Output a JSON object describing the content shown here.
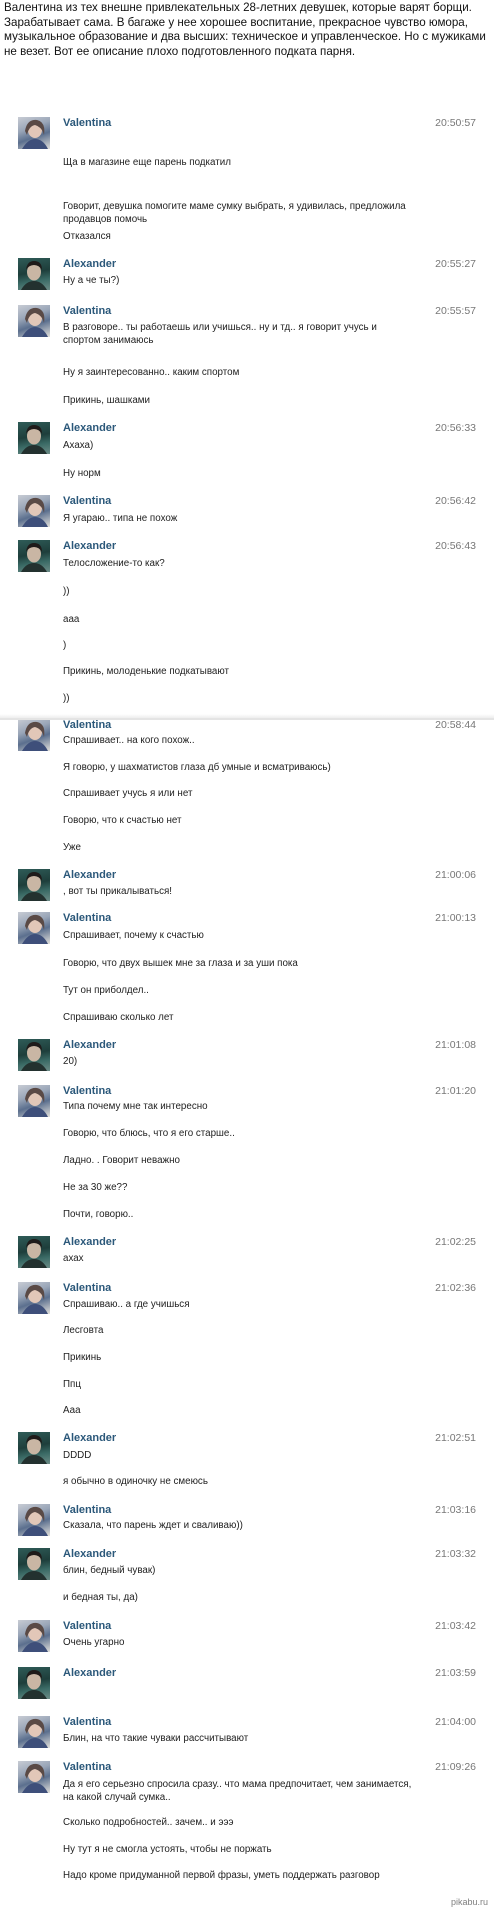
{
  "intro": "Валентина из тех внешне привлекательных 28-летних девушек, которые варят борщи. Зарабатывает сама. В багаже у нее хорошее воспитание, прекрасное чувство юмора, музыкальное образование и два высших: техническое и управленческое. Но с мужиками не везет. Вот ее описание плохо подготовленного подката парня.",
  "messages": [
    {
      "name": "Valentina",
      "time": "20:50:57",
      "lines": [
        "Ща в магазине еще парень подкатил",
        "Говорит, девушка помогите маме сумку выбрать, я удивилась, предложила продавцов помочь",
        "Отказался"
      ]
    },
    {
      "name": "Alexander",
      "time": "20:55:27",
      "lines": [
        "Ну а че ты?)"
      ]
    },
    {
      "name": "Valentina",
      "time": "20:55:57",
      "lines": [
        "В разговоре.. ты работаешь или учишься.. ну и тд.. я говорит учусь и спортом занимаюсь",
        "Ну я заинтересованно.. каким спортом",
        "Прикинь, шашками"
      ]
    },
    {
      "name": "Alexander",
      "time": "20:56:33",
      "lines": [
        "Ахаха)",
        "Ну норм"
      ]
    },
    {
      "name": "Valentina",
      "time": "20:56:42",
      "lines": [
        "Я угараю.. типа не похож"
      ]
    },
    {
      "name": "Alexander",
      "time": "20:56:43",
      "lines": [
        "Телосложение-то как?",
        "))",
        "ааа",
        ")",
        "Прикинь, молоденькие подкатывают",
        "))"
      ]
    },
    {
      "name": "Valentina",
      "time": "20:58:44",
      "lines": [
        "Спрашивает.. на кого похож..",
        "Я говорю, у шахматистов глаза дб умные и всматриваюсь)",
        "Спрашивает учусь я или нет",
        "Говорю, что к счастью нет",
        "Уже"
      ]
    },
    {
      "name": "Alexander",
      "time": "21:00:06",
      "lines": [
        ", вот ты прикалываться!"
      ]
    },
    {
      "name": "Valentina",
      "time": "21:00:13",
      "lines": [
        "Спрашивает, почему к счастью",
        "Говорю, что двух вышек мне за глаза и за уши пока",
        "Тут он приболдел..",
        "Спрашиваю сколько лет"
      ]
    },
    {
      "name": "Alexander",
      "time": "21:01:08",
      "lines": [
        "20)"
      ]
    },
    {
      "name": "Valentina",
      "time": "21:01:20",
      "lines": [
        "Типа почему мне так интересно",
        "Говорю, что блюсь, что я его старше..",
        "Ладно. . Говорит неважно",
        "Не за 30 же??",
        "Почти, говорю.."
      ]
    },
    {
      "name": "Alexander",
      "time": "21:02:25",
      "lines": [
        "ахах"
      ]
    },
    {
      "name": "Valentina",
      "time": "21:02:36",
      "lines": [
        "Спрашиваю.. а где учишься",
        "Лесговта",
        "Прикинь",
        "Ппц",
        "Ааа"
      ]
    },
    {
      "name": "Alexander",
      "time": "21:02:51",
      "lines": [
        "DDDD",
        "я обычно в одиночку не смеюсь"
      ]
    },
    {
      "name": "Valentina",
      "time": "21:03:16",
      "lines": [
        "Сказала, что парень ждет и сваливаю))"
      ]
    },
    {
      "name": "Alexander",
      "time": "21:03:32",
      "lines": [
        "блин, бедный чувак)",
        "и бедная ты, да)"
      ]
    },
    {
      "name": "Valentina",
      "time": "21:03:42",
      "lines": [
        "Очень угарно"
      ]
    },
    {
      "name": "Alexander",
      "time": "21:03:59",
      "lines": []
    },
    {
      "name": "Valentina",
      "time": "21:04:00",
      "lines": [
        "Блин, на что такие чуваки рассчитывают"
      ]
    },
    {
      "name": "Valentina",
      "time": "21:09:26",
      "lines": [
        "Да я его серьезно спросила сразу.. что мама предпочитает, чем занимается, на какой случай сумка..",
        "Сколько подробностей.. зачем.. и эээ",
        "Ну тут я не смогла устоять, чтобы не поржать",
        "Надо кроме придуманной первой фразы, уметь поддержать разговор"
      ]
    }
  ],
  "watermark": "pikabu.ru"
}
